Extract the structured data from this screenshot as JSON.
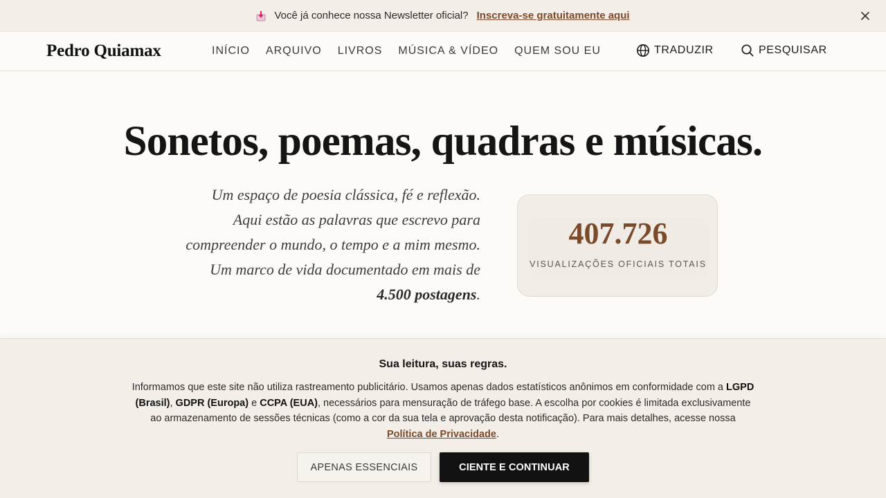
{
  "announcement": {
    "icon": "mail-inbox-icon",
    "message": "Você já conhece nossa Newsletter oficial?",
    "cta": "Inscreva-se gratuitamente aqui"
  },
  "header": {
    "brand": "Pedro Quiamax",
    "nav": [
      "INÍCIO",
      "ARQUIVO",
      "LIVROS",
      "MÚSICA & VÍDEO",
      "QUEM SOU EU"
    ],
    "translate_label": "TRADUZIR",
    "search_label": "PESQUISAR"
  },
  "hero": {
    "title": "Sonetos, poemas, quadras e músicas.",
    "intro_lines": [
      "Um espaço de poesia clássica, fé e reflexão.",
      "Aqui estão as palavras que escrevo para",
      "compreender o mundo, o tempo e a mim mesmo.",
      "Um marco de vida documentado em mais de"
    ],
    "post_count": "4.500 postagens",
    "post_count_suffix": "."
  },
  "stats": {
    "views": "407.726",
    "label": "VISUALIZAÇÕES OFICIAIS TOTAIS"
  },
  "cookie": {
    "title": "Sua leitura, suas regras.",
    "text_1": "Informamos que este site não utiliza rastreamento publicitário. Usamos apenas dados estatísticos anônimos em conformidade com a",
    "law_lgpd": "LGPD (Brasil)",
    "sep_1": ",",
    "law_gdpr": "GDPR (Europa)",
    "sep_2": "e",
    "law_ccpa": "CCPA (EUA)",
    "text_2": ", necessários para mensuração de tráfego base. A escolha por cookies é limitada exclusivamente ao armazenamento de sessões técnicas (como a cor da sua tela e aprovação desta notificação). Para mais detalhes, acesse nossa",
    "privacy_link": "Política de Privacidade",
    "text_end": ".",
    "essential_button": "APENAS ESSENCIAIS",
    "accept_button": "CIENTE E CONTINUAR"
  },
  "colors": {
    "accent": "#7a4a2a",
    "background": "#fcfbf8",
    "bar_background": "#f3efe8",
    "dark_button": "#121212"
  }
}
